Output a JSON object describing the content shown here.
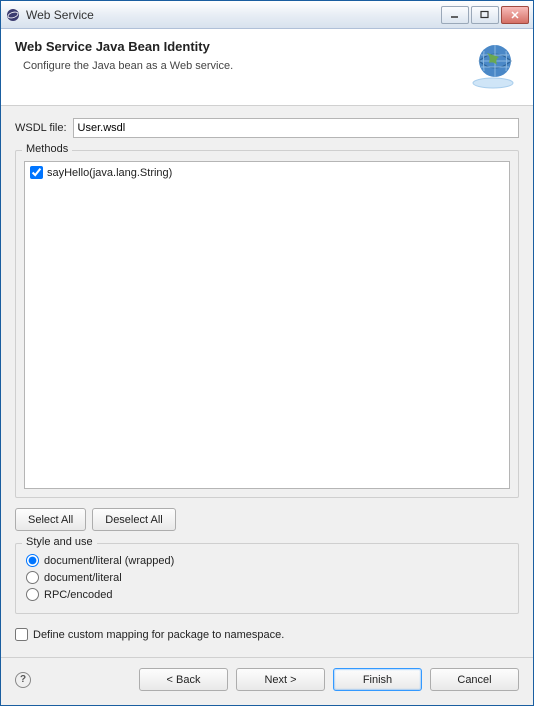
{
  "window": {
    "title": "Web Service"
  },
  "header": {
    "title": "Web Service Java Bean Identity",
    "subtitle": "Configure the Java bean as a Web service."
  },
  "wsdl": {
    "label": "WSDL file:",
    "value": "User.wsdl"
  },
  "methods": {
    "legend": "Methods",
    "items": [
      {
        "checked": true,
        "label": "sayHello(java.lang.String)"
      }
    ]
  },
  "buttons": {
    "select_all": "Select All",
    "deselect_all": "Deselect All"
  },
  "style": {
    "legend": "Style and use",
    "options": [
      {
        "label": "document/literal (wrapped)",
        "checked": true
      },
      {
        "label": "document/literal",
        "checked": false
      },
      {
        "label": "RPC/encoded",
        "checked": false
      }
    ]
  },
  "custom_mapping": {
    "label": "Define custom mapping for package to namespace.",
    "checked": false
  },
  "footer": {
    "back": "< Back",
    "next": "Next >",
    "finish": "Finish",
    "cancel": "Cancel"
  }
}
